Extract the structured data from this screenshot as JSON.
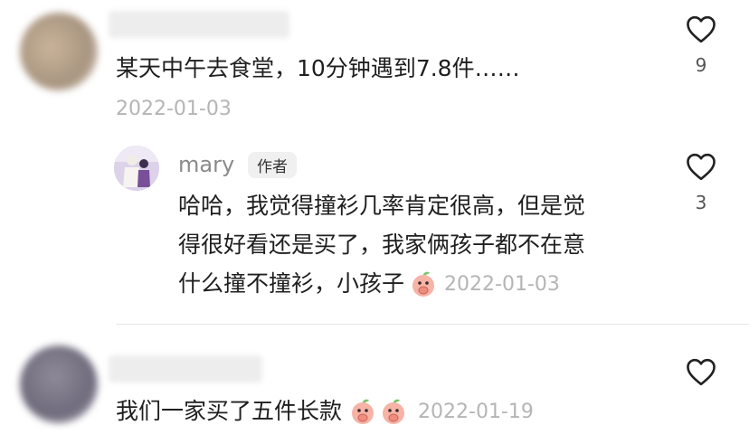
{
  "comments": [
    {
      "text": "某天中午去食堂，10分钟遇到7.8件……",
      "date": "2022-01-03",
      "likes": "9",
      "reply": {
        "name": "mary",
        "badge": "作者",
        "lines": [
          "哈哈，我觉得撞衫几率肯定很高，但是觉",
          "得很好看还是买了，我家俩孩子都不在意",
          "什么撞不撞衫，小孩子"
        ],
        "date": "2022-01-03",
        "likes": "3"
      }
    },
    {
      "text": "我们一家买了五件长款",
      "date": "2022-01-19",
      "likes": ""
    }
  ],
  "icons": {
    "like": "heart-outline-icon",
    "emoji": "peach-cover-mouth-emoji"
  },
  "colors": {
    "date": "#b5b5b5",
    "badge_bg": "#f0f0f0"
  }
}
